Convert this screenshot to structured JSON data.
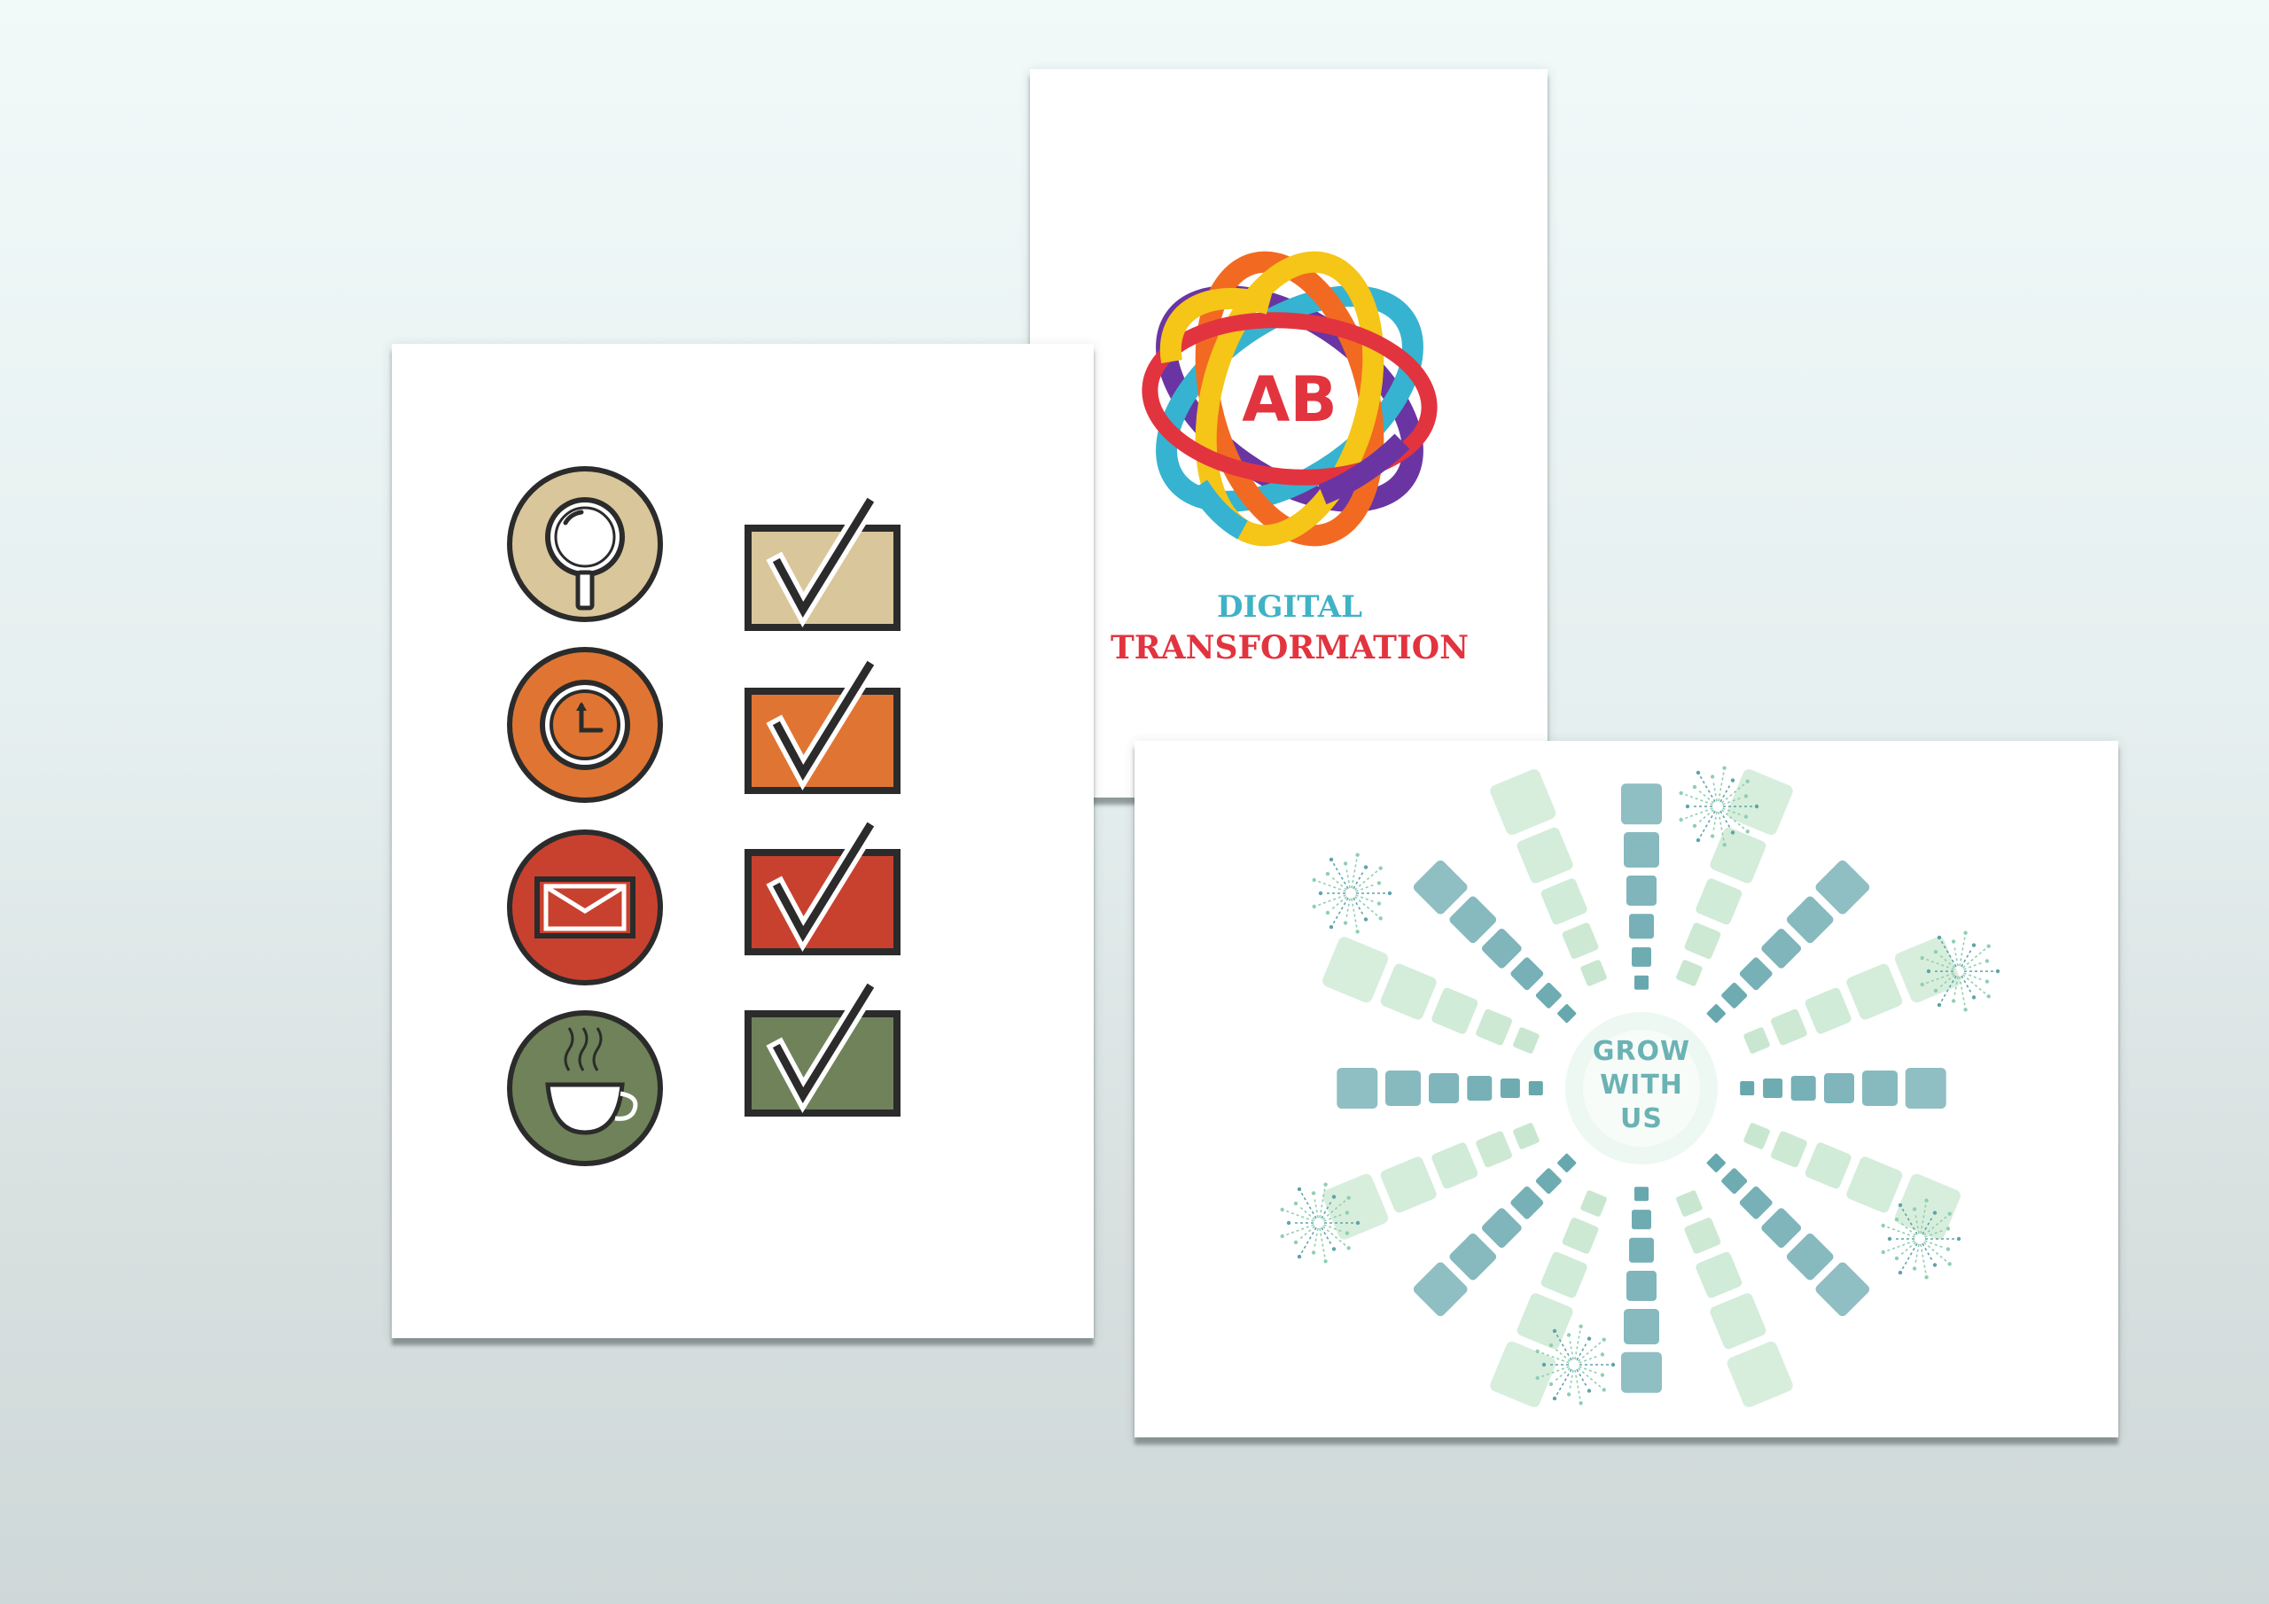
{
  "logo_card": {
    "monogram": "AB",
    "line1": "DIGITAL",
    "line2": "TRANSFORMATION",
    "colors": {
      "line1": "#3fb2c6",
      "line2": "#e2343f",
      "monogram": "#e2343f",
      "rings": [
        "#f5c518",
        "#f26a21",
        "#e2343f",
        "#6a35a3",
        "#36b3d0"
      ]
    }
  },
  "checklist_card": {
    "items": [
      {
        "icon": "magnifier-icon",
        "fill": "#d9c69a",
        "checked": true
      },
      {
        "icon": "clock-icon",
        "fill": "#e07533",
        "checked": true
      },
      {
        "icon": "envelope-icon",
        "fill": "#c8412f",
        "checked": true
      },
      {
        "icon": "coffee-cup-icon",
        "fill": "#6f8259",
        "checked": true
      }
    ]
  },
  "grow_card": {
    "line1": "GROW",
    "line2": "WITH",
    "line3": "US",
    "colors": {
      "text": "#6bb2b4",
      "dark_tile": "#5fa3aa",
      "light_tile": "#bfe3c8"
    }
  }
}
